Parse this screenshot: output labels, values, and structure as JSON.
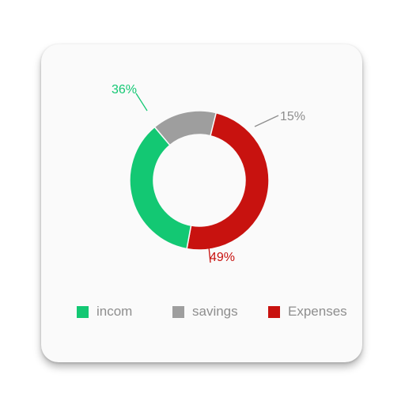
{
  "chart_data": {
    "type": "pie",
    "donut": true,
    "categories": [
      "incom",
      "savings",
      "Expenses"
    ],
    "values": [
      36,
      15,
      49
    ],
    "data_labels": [
      "36%",
      "15%",
      "49%"
    ],
    "colors": [
      "#13c873",
      "#9e9e9e",
      "#c8120f"
    ],
    "label_colors": [
      "#13c873",
      "#8e8e8e",
      "#c8120f"
    ],
    "legend_position": "bottom",
    "title": "",
    "xlabel": "",
    "ylabel": ""
  }
}
